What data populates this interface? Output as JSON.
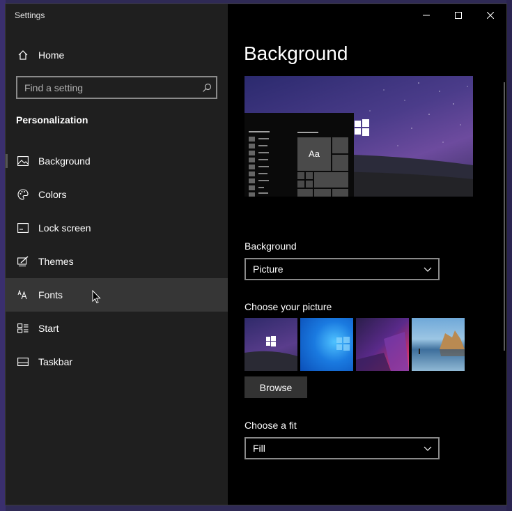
{
  "window": {
    "title": "Settings"
  },
  "sidebar": {
    "home_label": "Home",
    "search": {
      "placeholder": "Find a setting"
    },
    "section_title": "Personalization",
    "items": [
      {
        "label": "Background",
        "icon": "picture-icon"
      },
      {
        "label": "Colors",
        "icon": "palette-icon"
      },
      {
        "label": "Lock screen",
        "icon": "lock-screen-icon"
      },
      {
        "label": "Themes",
        "icon": "themes-brush-icon"
      },
      {
        "label": "Fonts",
        "icon": "fonts-icon"
      },
      {
        "label": "Start",
        "icon": "start-icon"
      },
      {
        "label": "Taskbar",
        "icon": "taskbar-icon"
      }
    ]
  },
  "main": {
    "title": "Background",
    "preview": {
      "sample_text": "Aa"
    },
    "background_section": {
      "label": "Background",
      "value": "Picture"
    },
    "choose_picture": {
      "label": "Choose your picture",
      "browse_label": "Browse"
    },
    "choose_fit": {
      "label": "Choose a fit",
      "value": "Fill"
    }
  },
  "colors": {
    "accent": "#000000",
    "sidebar_bg": "#1f1f1f",
    "hover_bg": "#363636"
  }
}
